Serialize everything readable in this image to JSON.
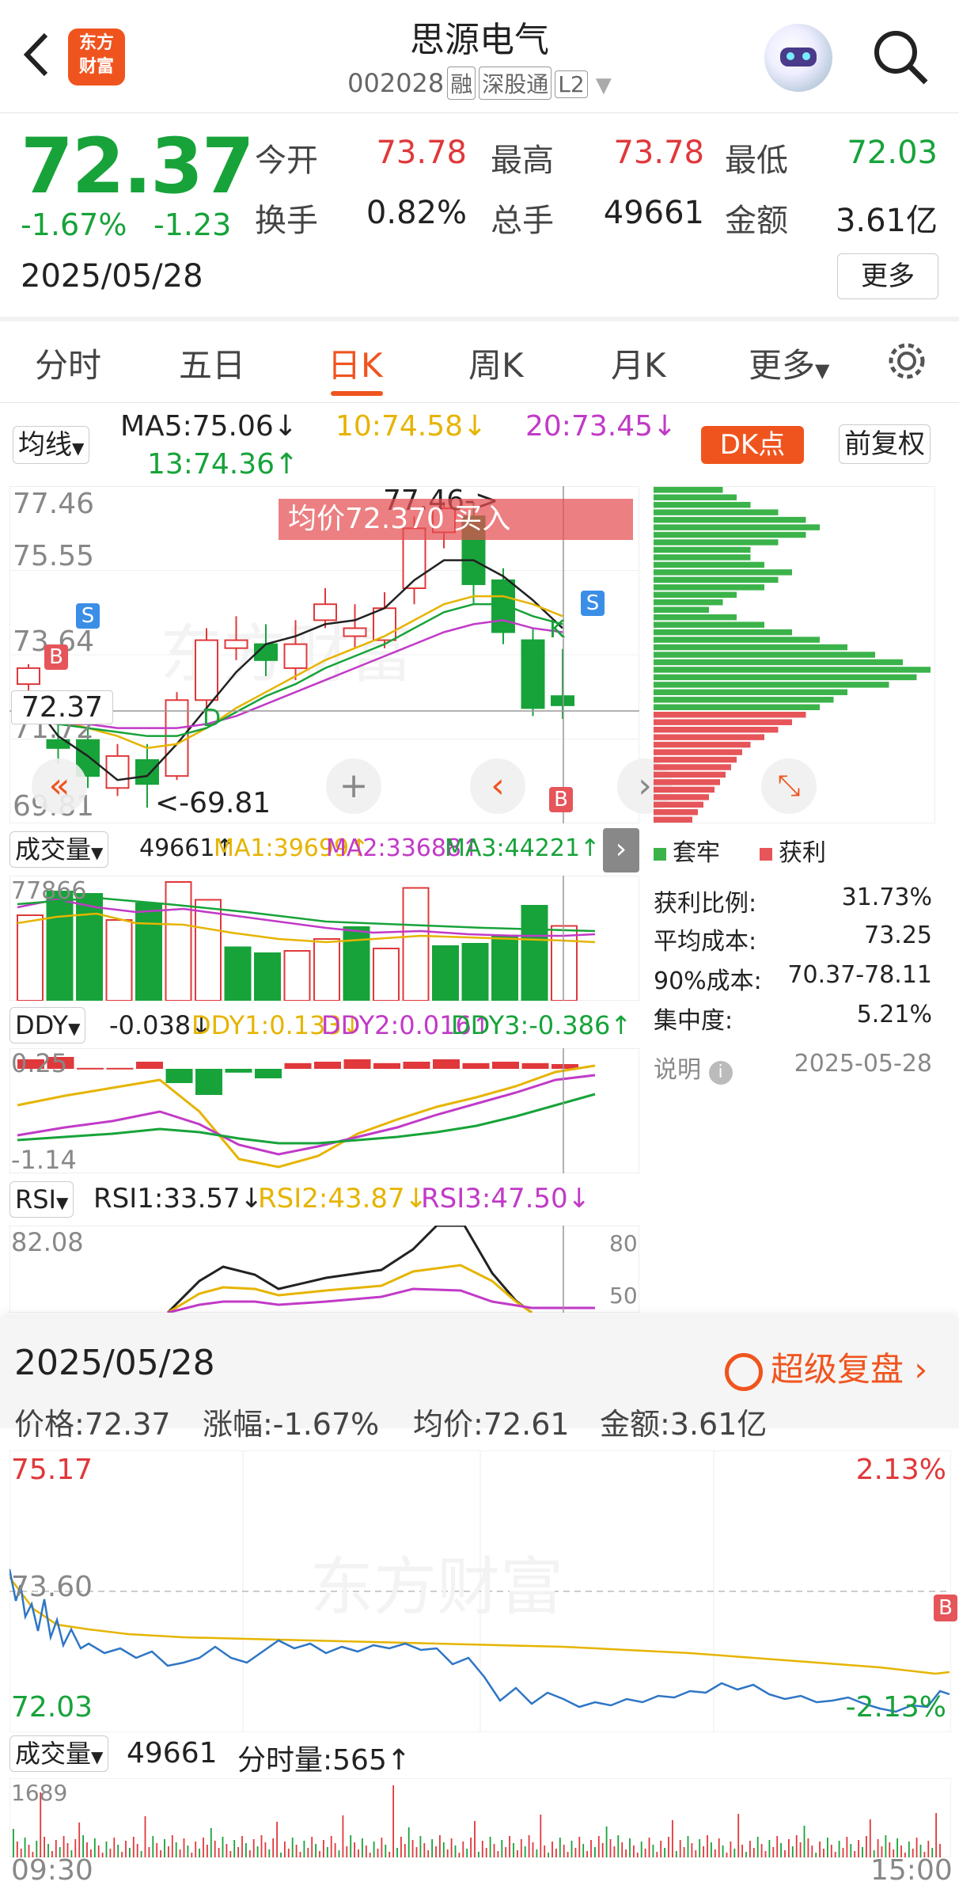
{
  "header": {
    "title": "思源电气",
    "code": "002028",
    "tag_rong": "融",
    "tag_sgt": "深股通",
    "tag_l2": "L2",
    "logo_line1": "东方",
    "logo_line2": "财富"
  },
  "quote": {
    "price": "72.37",
    "change_pct": "-1.67%",
    "change": "-1.23",
    "date": "2025/05/28",
    "fields": [
      {
        "label": "今开",
        "value": "73.78",
        "color": "#e0383b"
      },
      {
        "label": "最高",
        "value": "73.78",
        "color": "#e0383b"
      },
      {
        "label": "最低",
        "value": "72.03",
        "color": "#17a33a"
      },
      {
        "label": "换手",
        "value": "0.82%",
        "color": "#222222"
      },
      {
        "label": "总手",
        "value": "49661",
        "color": "#222222"
      },
      {
        "label": "金额",
        "value": "3.61亿",
        "color": "#222222"
      }
    ],
    "more": "更多"
  },
  "tabs": [
    "分时",
    "五日",
    "日K",
    "周K",
    "月K",
    "更多"
  ],
  "active_tab": "日K",
  "kline": {
    "ma_selector": "均线",
    "ma5": "MA5:75.06↓",
    "ma10": "10:74.58↓",
    "ma20": "20:73.45↓",
    "ma13": "13:74.36↑",
    "dk_button": "DK点",
    "adjust_button": "前复权",
    "y_labels": [
      "77.46",
      "75.55",
      "73.64",
      "71.72",
      "69.81"
    ],
    "high_marker": "77.46->",
    "low_marker": "<-69.81",
    "price_tag": "72.37",
    "avg_banner": "均价72.370  买入",
    "marker_s": "S",
    "marker_b": "B",
    "marker_k": "K",
    "marker_d": "D",
    "candles": [
      {
        "o": 72.9,
        "c": 73.3,
        "h": 73.4,
        "l": 72.6
      },
      {
        "o": 71.5,
        "c": 71.3,
        "h": 72.0,
        "l": 70.9
      },
      {
        "o": 71.5,
        "c": 70.6,
        "h": 71.8,
        "l": 70.3
      },
      {
        "o": 70.3,
        "c": 71.1,
        "h": 71.4,
        "l": 70.1
      },
      {
        "o": 71.0,
        "c": 70.4,
        "h": 71.4,
        "l": 69.81
      },
      {
        "o": 70.6,
        "c": 72.5,
        "h": 72.7,
        "l": 70.5
      },
      {
        "o": 72.5,
        "c": 74.0,
        "h": 74.3,
        "l": 72.3
      },
      {
        "o": 73.8,
        "c": 74.0,
        "h": 74.6,
        "l": 73.5
      },
      {
        "o": 73.9,
        "c": 73.5,
        "h": 74.4,
        "l": 73.1
      },
      {
        "o": 73.3,
        "c": 73.9,
        "h": 74.5,
        "l": 73.0
      },
      {
        "o": 74.5,
        "c": 74.9,
        "h": 75.3,
        "l": 74.3
      },
      {
        "o": 74.1,
        "c": 74.3,
        "h": 74.9,
        "l": 73.8
      },
      {
        "o": 74.0,
        "c": 74.8,
        "h": 75.2,
        "l": 73.8
      },
      {
        "o": 75.3,
        "c": 76.8,
        "h": 77.1,
        "l": 74.9
      },
      {
        "o": 76.7,
        "c": 77.3,
        "h": 77.46,
        "l": 76.3
      },
      {
        "o": 77.1,
        "c": 75.4,
        "h": 77.46,
        "l": 74.9
      },
      {
        "o": 75.5,
        "c": 74.2,
        "h": 75.8,
        "l": 73.9
      },
      {
        "o": 74.0,
        "c": 72.3,
        "h": 74.3,
        "l": 72.1
      },
      {
        "o": 72.6,
        "c": 72.37,
        "h": 73.78,
        "l": 72.03
      }
    ],
    "ma5_line": [
      72.6,
      71.6,
      71.1,
      70.5,
      70.6,
      71.4,
      72.3,
      73.2,
      73.9,
      74.1,
      74.4,
      74.5,
      74.8,
      75.5,
      76.0,
      76.0,
      75.6,
      75.0,
      74.3
    ],
    "ma10_line": [
      72.3,
      72.0,
      71.8,
      71.6,
      71.3,
      71.4,
      71.8,
      72.3,
      72.7,
      73.1,
      73.5,
      73.8,
      74.1,
      74.5,
      74.9,
      75.1,
      75.1,
      74.9,
      74.6
    ],
    "ma20_line": [
      72.0,
      71.9,
      71.9,
      71.8,
      71.8,
      71.8,
      71.9,
      72.1,
      72.4,
      72.7,
      73.0,
      73.3,
      73.6,
      73.9,
      74.2,
      74.4,
      74.5,
      74.3,
      74.2
    ],
    "ma13_line": [
      72.1,
      71.9,
      71.8,
      71.7,
      71.6,
      71.6,
      71.8,
      72.2,
      72.6,
      72.9,
      73.3,
      73.6,
      73.9,
      74.3,
      74.7,
      74.9,
      74.9,
      74.6,
      74.4
    ]
  },
  "chip": {
    "legend_trapped": "套牢",
    "legend_profit": "获利",
    "rows": [
      {
        "label": "获利比例:",
        "value": "31.73%"
      },
      {
        "label": "平均成本:",
        "value": "73.25"
      },
      {
        "label": "90%成本:",
        "value": "70.37-78.11"
      },
      {
        "label": "集中度:",
        "value": "5.21%"
      }
    ],
    "note_label": "说明",
    "note_date": "2025-05-28",
    "profile": [
      0.25,
      0.3,
      0.35,
      0.45,
      0.55,
      0.6,
      0.55,
      0.45,
      0.35,
      0.35,
      0.4,
      0.5,
      0.45,
      0.4,
      0.3,
      0.25,
      0.2,
      0.3,
      0.4,
      0.5,
      0.6,
      0.7,
      0.8,
      0.9,
      1.0,
      0.95,
      0.85,
      0.7,
      0.65,
      0.6,
      0.55,
      0.5,
      0.45,
      0.4,
      0.35,
      0.32,
      0.3,
      0.28,
      0.26,
      0.24,
      0.22,
      0.2,
      0.18,
      0.16,
      0.14
    ]
  },
  "volume": {
    "selector": "成交量",
    "value": "49661↑",
    "ma1": "MA1:39699↑",
    "ma2": "MA2:33688↑",
    "ma3": "MA3:44221↑",
    "max_label": "77866",
    "bars": [
      0.72,
      0.92,
      0.9,
      0.68,
      0.82,
      1.0,
      0.85,
      0.45,
      0.4,
      0.42,
      0.52,
      0.62,
      0.44,
      0.95,
      0.46,
      0.48,
      0.55,
      0.8,
      0.63
    ],
    "up": [
      true,
      false,
      false,
      true,
      false,
      true,
      true,
      false,
      false,
      true,
      true,
      false,
      true,
      true,
      false,
      false,
      false,
      false,
      true
    ]
  },
  "ddy": {
    "selector": "DDY",
    "value": "-0.038↓",
    "ddy1": "DDY1:0.133↓",
    "ddy2": "DDY2:0.016↑",
    "ddy3": "DDY3:-0.386↑",
    "top_label": "0.25",
    "bottom_label": "-1.14",
    "bars": [
      0.2,
      0.25,
      0.02,
      0.02,
      0.15,
      -0.3,
      -0.55,
      -0.08,
      -0.2,
      0.12,
      0.15,
      0.2,
      0.12,
      0.15,
      0.2,
      0.12,
      0.15,
      0.12,
      0.1
    ]
  },
  "rsi": {
    "selector": "RSI",
    "rsi1": "RSI1:33.57↓",
    "rsi2": "RSI2:43.87↓",
    "rsi3": "RSI3:47.50↓",
    "top_label": "82.08",
    "level80": "80",
    "level50": "50"
  },
  "intraday": {
    "date": "2025/05/28",
    "replay": "超级复盘",
    "price": "价格:72.37",
    "change": "涨幅:-1.67%",
    "avg": "均价:72.61",
    "amount": "金额:3.61亿",
    "high": "75.17",
    "high_pct": "2.13%",
    "ref": "73.60",
    "low": "72.03",
    "low_pct": "-2.13%",
    "vol_selector": "成交量",
    "vol_value": "49661",
    "vol_tick": "分时量:565↑",
    "vol_max": "1689",
    "time_start": "09:30",
    "time_end": "15:00",
    "watermark": "东方财富"
  },
  "colors": {
    "up": "#e0383b",
    "down": "#17a33a",
    "accent": "#f0541e",
    "ma5": "#222222",
    "ma10": "#e6b400",
    "ma20": "#c13ac7",
    "ma13": "#17a33a"
  }
}
